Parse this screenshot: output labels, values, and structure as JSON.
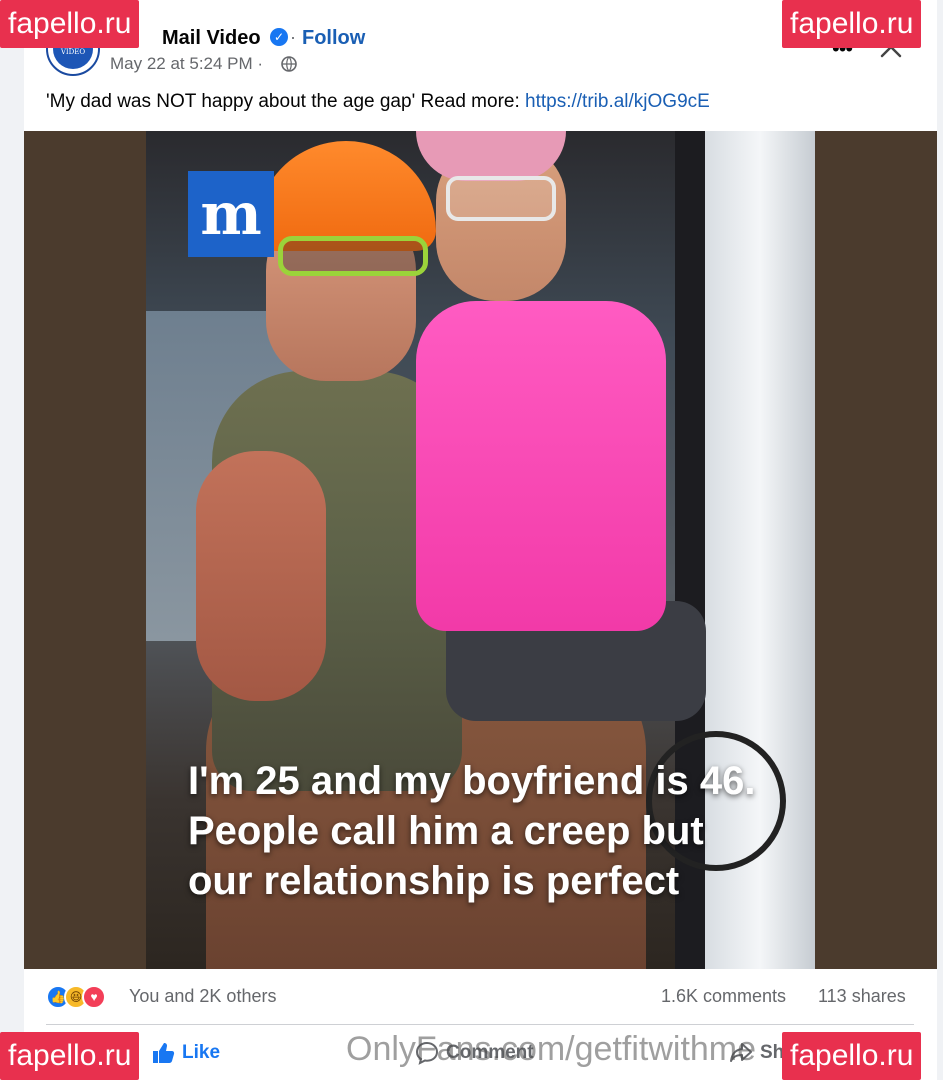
{
  "post": {
    "page_name": "Mail Video",
    "avatar_text": "Daily Mail VIDEO",
    "follow_label": "Follow",
    "time": "May 22 at 5:24 PM ·",
    "text": "'My dad was NOT happy about the age gap' Read more: ",
    "link": "https://trib.al/kjOG9cE"
  },
  "image": {
    "logo_letter": "m",
    "headline": "I'm 25 and my boyfriend is 46. People call him a creep but our relationship is perfect"
  },
  "stats": {
    "reactions_text": "You and 2K others",
    "comments": "1.6K comments",
    "shares": "113 shares"
  },
  "actions": {
    "like": "Like",
    "comment": "Comment",
    "share": "Share"
  },
  "watermarks": {
    "corner": "fapello.ru",
    "onlyfans": "OnlyFans.com/getfitwithme"
  },
  "colors": {
    "accent": "#1877f2",
    "link": "#1a5fb4",
    "watermark": "#e8304e"
  },
  "icons": [
    "verified-icon",
    "globe-icon",
    "more-icon",
    "close-icon",
    "like-reaction-icon",
    "haha-reaction-icon",
    "love-reaction-icon",
    "like-icon",
    "comment-icon",
    "share-icon"
  ]
}
